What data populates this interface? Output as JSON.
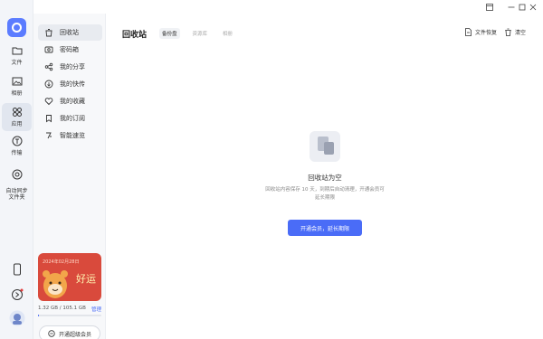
{
  "rail": {
    "items": [
      {
        "label": "文件"
      },
      {
        "label": "相册"
      },
      {
        "label": "应用"
      },
      {
        "label": "传输"
      },
      {
        "label": "自动同步\n文件夹"
      }
    ]
  },
  "sidebar": {
    "items": [
      {
        "label": "回收站",
        "icon": "trash-icon"
      },
      {
        "label": "密码箱",
        "icon": "safe-icon"
      },
      {
        "label": "我的分享",
        "icon": "share-icon"
      },
      {
        "label": "我的快传",
        "icon": "cloud-transfer-icon"
      },
      {
        "label": "我的收藏",
        "icon": "heart-icon"
      },
      {
        "label": "我的订阅",
        "icon": "bookmark-icon"
      },
      {
        "label": "智能速览",
        "icon": "smart-preview-icon"
      }
    ],
    "promo": {
      "date": "2024年02月28日",
      "text": "好运"
    },
    "storage": {
      "text": "1.32 GB / 105.1 GB",
      "manage": "管理",
      "used_fraction": 0.0126
    },
    "upgrade_button": "开通超级会员"
  },
  "main": {
    "title": "回收站",
    "tabs": [
      {
        "label": "备份盘",
        "active": true
      },
      {
        "label": "资源库",
        "active": false
      },
      {
        "label": "相册",
        "active": false
      }
    ],
    "actions": {
      "restore": "文件恢复",
      "clear": "清空"
    },
    "empty": {
      "title": "回收站为空",
      "line1": "回收站内容保存 10 天，到期后自动清理，开通会员可",
      "line2": "延长期限",
      "button": "开通会员，延长期限"
    }
  },
  "colors": {
    "accent": "#4a6cf7",
    "promo": "#d94a3c"
  }
}
